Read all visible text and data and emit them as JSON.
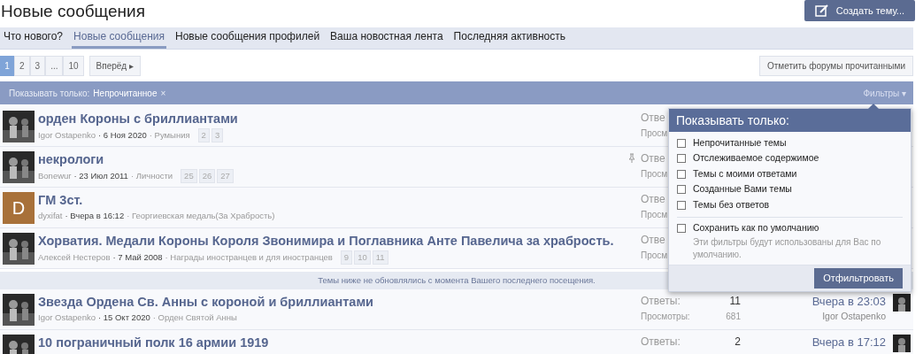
{
  "page_title": "Новые сообщения",
  "create_button": "Создать тему...",
  "tabs": [
    {
      "label": "Что нового?",
      "selected": false
    },
    {
      "label": "Новые сообщения",
      "selected": true
    },
    {
      "label": "Новые сообщения профилей",
      "selected": false
    },
    {
      "label": "Ваша новостная лента",
      "selected": false
    },
    {
      "label": "Последняя активность",
      "selected": false
    }
  ],
  "pagination": {
    "pages": [
      {
        "label": "1",
        "selected": true
      },
      {
        "label": "2",
        "selected": false
      },
      {
        "label": "3",
        "selected": false
      },
      {
        "label": "...",
        "selected": false
      },
      {
        "label": "10",
        "selected": false
      }
    ],
    "next": "Вперёд ▸"
  },
  "mark_read_button": "Отметить форумы прочитанными",
  "filter_bar": {
    "label": "Показывать только:",
    "active_filter": "Непрочитанное",
    "remove": "×",
    "filters_toggle": "Фильтры ▾"
  },
  "threads": [
    {
      "title": "орден Короны с бриллиантами",
      "author": "Igor Ostapenko",
      "date": "· 6 Ноя 2020",
      "forum": "· Румыния",
      "pages": [
        "2",
        "3"
      ],
      "avatar": {
        "kind": "picture"
      },
      "sticky": false,
      "replies_label": "Отве",
      "views_label": "Просм"
    },
    {
      "title": "некрологи",
      "author": "Bonewur",
      "date": "· 23 Июл 2011",
      "forum": "· Личности",
      "pages": [
        "25",
        "26",
        "27"
      ],
      "avatar": {
        "kind": "picture"
      },
      "sticky": true,
      "replies_label": "Отве",
      "views_label": "Просм"
    },
    {
      "title": "ГМ 3ст.",
      "author": "dyxifat",
      "date": "· Вчера в 16:12",
      "forum": "· Георгиевская медаль(За Храбрость)",
      "avatar": {
        "kind": "letter",
        "letter": "D",
        "color": "#a8713a"
      },
      "sticky": false,
      "replies_label": "Отве",
      "views_label": "Просм"
    },
    {
      "title": "Хорватия. Медали Короны Короля Звонимира и Поглавника Анте Павелича за храбрость.",
      "author": "Алексей Нестеров",
      "date": "· 7 Май 2008",
      "forum": "· Награды иностранцев и для иностранцев",
      "pages": [
        "9",
        "10",
        "11"
      ],
      "avatar": {
        "kind": "picture"
      },
      "sticky": false,
      "replies_label": "Отве",
      "views_label": "Просм"
    }
  ],
  "notice": "Темы ниже не обновлялись с момента Вашего последнего посещения.",
  "old_threads": [
    {
      "title": "Звезда Ордена Св. Анны с короной и бриллиантами",
      "author": "Igor Ostapenko",
      "date": "· 15 Окт 2020",
      "forum": "· Орден Святой Анны",
      "avatar": {
        "kind": "picture"
      },
      "sticky": false,
      "replies_label": "Ответы:",
      "replies": "11",
      "views_label": "Просмотры:",
      "views": "681",
      "last_time": "Вчера в 23:03",
      "last_user": "Igor Ostapenko"
    },
    {
      "title": "10 пограничный полк 16 армии 1919",
      "avatar": {
        "kind": "picture"
      },
      "sticky": false,
      "replies_label": "Ответы:",
      "replies": "2",
      "last_time": "Вчера в 17:12"
    }
  ],
  "filter_popup": {
    "title": "Показывать только:",
    "options": [
      {
        "label": "Непрочитанные темы",
        "checked": false
      },
      {
        "label": "Отслеживаемое содержимое",
        "checked": false
      },
      {
        "label": "Темы с моими ответами",
        "checked": false
      },
      {
        "label": "Созданные Вами темы",
        "checked": false
      },
      {
        "label": "Темы без ответов",
        "checked": false
      }
    ],
    "save_default": {
      "label": "Сохранить как по умолчанию",
      "checked": false,
      "hint": "Эти фильтры будут использованы для Вас по умолчанию."
    },
    "apply_button": "Отфильтровать"
  }
}
